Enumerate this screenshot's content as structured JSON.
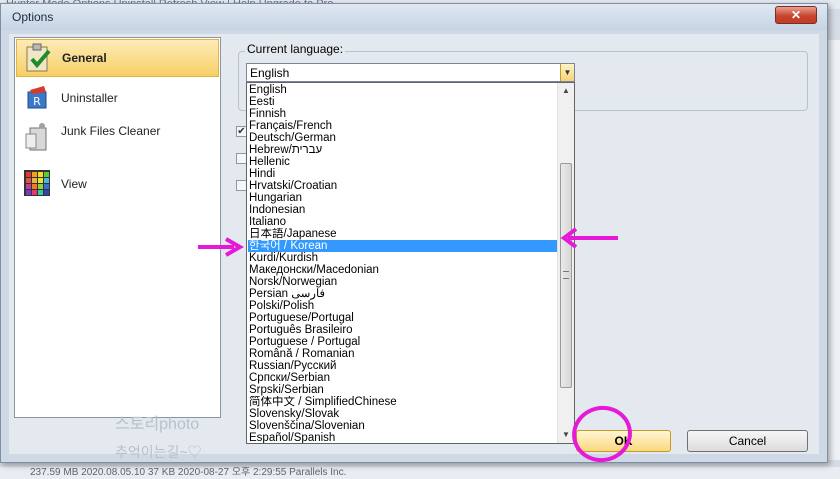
{
  "background": {
    "menubar_text": "Hunter Mode   Options   Uninstall Refresh   View   |  Help   Upgrade to Pro",
    "status_text": "237.59 MB   2020.08.05.10   37 KB   2020-08-27 오후 2:29:55   Parallels Inc."
  },
  "dialog": {
    "title": "Options",
    "close_symbol": "✕"
  },
  "nav": {
    "items": [
      {
        "label": "General",
        "selected": true
      },
      {
        "label": "Uninstaller"
      },
      {
        "label": "Junk Files Cleaner"
      },
      {
        "label": "View"
      }
    ]
  },
  "language": {
    "group_label": "Current language:",
    "current_value": "English",
    "options": [
      "English",
      "Eesti",
      "Finnish",
      "Français/French",
      "Deutsch/German",
      "Hebrew/עברית",
      "Hellenic",
      "Hindi",
      "Hrvatski/Croatian",
      "Hungarian",
      "Indonesian",
      "Italiano",
      "日本語/Japanese",
      "한국어 / Korean",
      "Kurdi/Kurdish",
      "Македонски/Macedonian",
      "Norsk/Norwegian",
      "Persian فارسی",
      "Polski/Polish",
      "Portuguese/Portugal",
      "Português Brasileiro",
      "Portuguese / Portugal",
      "Română / Romanian",
      "Russian/Русский",
      "Српски/Serbian",
      "Srpski/Serbian",
      "简体中文 / SimplifiedChinese",
      "Slovensky/Slovak",
      "Slovenščina/Slovenian",
      "Español/Spanish"
    ],
    "highlighted_index": 13
  },
  "checkboxes": [
    {
      "checked": true
    },
    {
      "checked": false
    },
    {
      "checked": false
    }
  ],
  "buttons": {
    "ok": "OK",
    "cancel": "Cancel"
  },
  "watermark": {
    "line1": "스토리photo",
    "line2": "추억이는길~♡"
  },
  "colors": {
    "selection": "#3399ff",
    "annotation": "#e619d9",
    "nav_selected": "#f7cf67"
  }
}
